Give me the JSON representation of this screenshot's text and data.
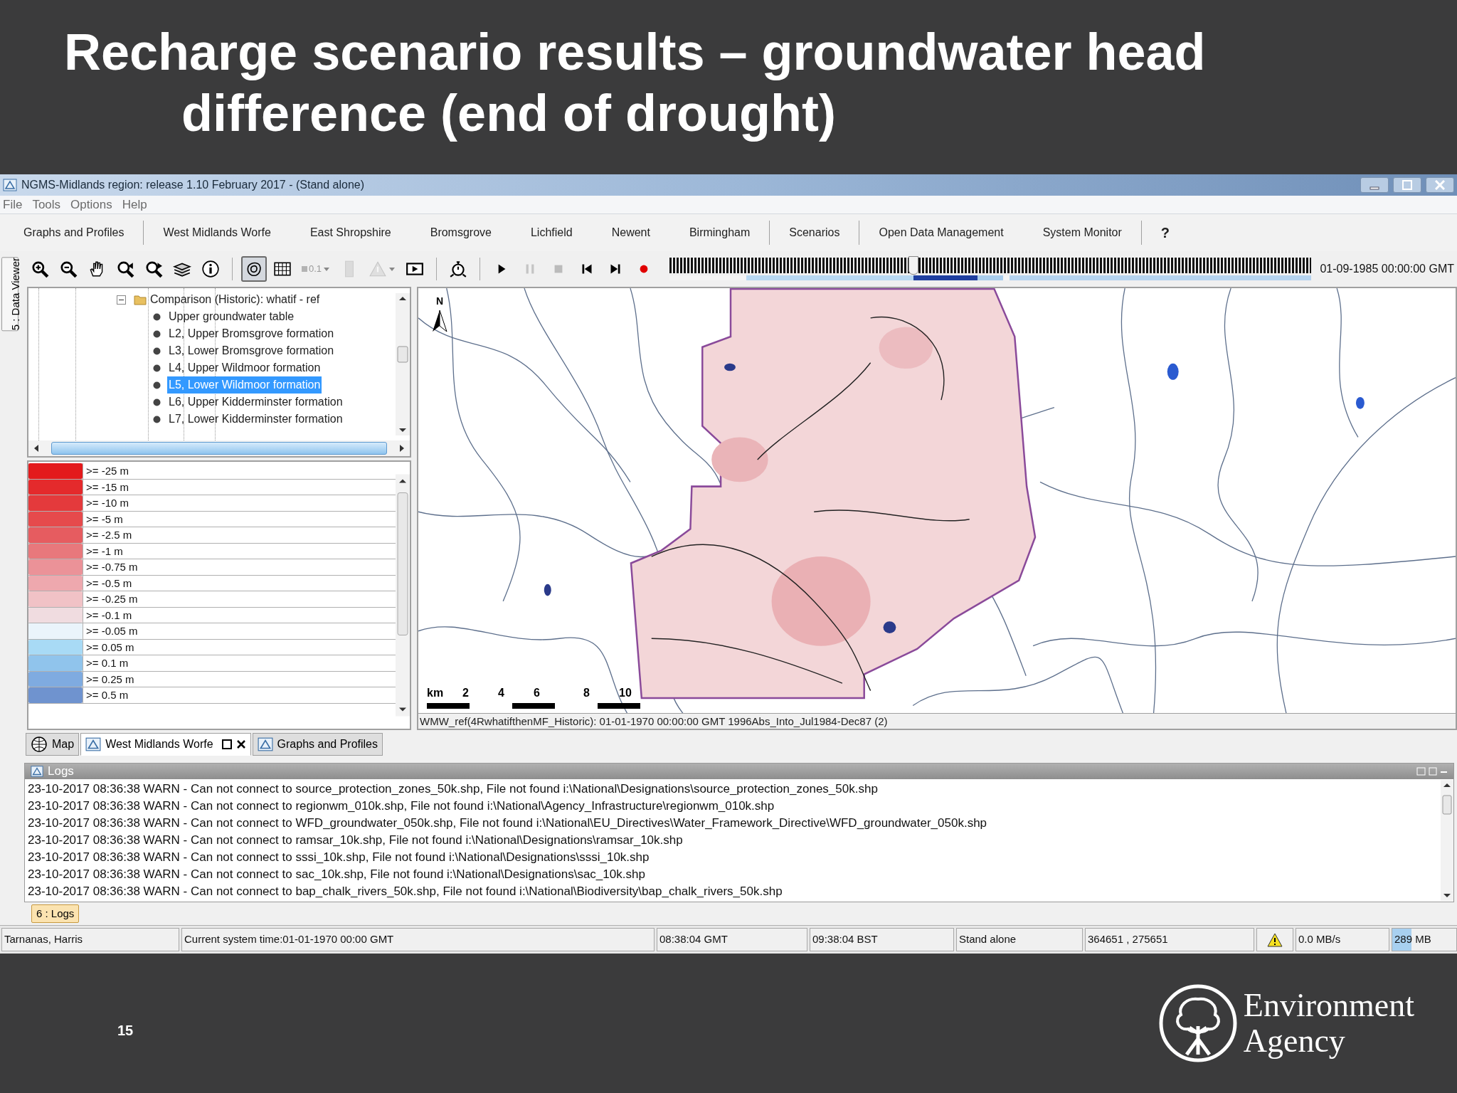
{
  "slide": {
    "title_lines": [
      "Recharge scenario results – groundwater head",
      "difference (end of drought)"
    ],
    "page_number": "15",
    "logo_lines": [
      "Environment",
      "Agency"
    ]
  },
  "window": {
    "title": "NGMS-Midlands region: release 1.10 February 2017 -  (Stand alone)",
    "menu": [
      "File",
      "Tools",
      "Options",
      "Help"
    ],
    "nav_tabs": [
      {
        "label": "Graphs and Profiles",
        "group_end": true
      },
      {
        "label": "West Midlands Worfe",
        "group_end": false
      },
      {
        "label": "East Shropshire",
        "group_end": false
      },
      {
        "label": "Bromsgrove",
        "group_end": false
      },
      {
        "label": "Lichfield",
        "group_end": false
      },
      {
        "label": "Newent",
        "group_end": false
      },
      {
        "label": "Birmingham",
        "group_end": true
      },
      {
        "label": "Scenarios",
        "group_end": true
      },
      {
        "label": "Open Data Management",
        "group_end": false
      },
      {
        "label": "System Monitor",
        "group_end": true
      },
      {
        "label": "?",
        "group_end": false
      }
    ]
  },
  "toolbar": [
    {
      "kind": "zoom-in",
      "pressed": false,
      "disabled": false
    },
    {
      "kind": "zoom-out",
      "pressed": false,
      "disabled": false
    },
    {
      "kind": "pan",
      "pressed": false,
      "disabled": false
    },
    {
      "kind": "zoom-back",
      "pressed": false,
      "disabled": false
    },
    {
      "kind": "zoom-forward",
      "pressed": false,
      "disabled": false
    },
    {
      "kind": "layers",
      "pressed": false,
      "disabled": false
    },
    {
      "kind": "info",
      "pressed": false,
      "disabled": false
    },
    {
      "kind": "separator"
    },
    {
      "kind": "contour",
      "pressed": true,
      "disabled": false
    },
    {
      "kind": "grid",
      "pressed": false,
      "disabled": false
    },
    {
      "kind": "opacity",
      "text": "0.1",
      "pressed": false,
      "disabled": true
    },
    {
      "kind": "bar",
      "pressed": false,
      "disabled": true
    },
    {
      "kind": "warning",
      "pressed": false,
      "disabled": true
    },
    {
      "kind": "present",
      "pressed": false,
      "disabled": false
    },
    {
      "kind": "separator"
    },
    {
      "kind": "timer",
      "pressed": false,
      "disabled": false
    },
    {
      "kind": "separator"
    },
    {
      "kind": "play",
      "pressed": false,
      "disabled": false
    },
    {
      "kind": "pause",
      "pressed": false,
      "disabled": true
    },
    {
      "kind": "stop",
      "pressed": false,
      "disabled": true
    },
    {
      "kind": "first",
      "pressed": false,
      "disabled": false
    },
    {
      "kind": "last",
      "pressed": false,
      "disabled": false
    },
    {
      "kind": "record",
      "pressed": false,
      "disabled": false
    }
  ],
  "time_slider": {
    "level": 0.38,
    "time": "01-09-1985 00:00:00 GMT"
  },
  "side_tab": "5 : Data Viewer",
  "tree": {
    "label": "Comparison (Historic): whatif - ref",
    "expanded": true,
    "children": [
      {
        "label": "Upper groundwater table",
        "selected": false
      },
      {
        "label": "L2, Upper Bromsgrove formation",
        "selected": false
      },
      {
        "label": "L3, Lower Bromsgrove formation",
        "selected": false
      },
      {
        "label": "L4, Upper Wildmoor formation",
        "selected": false
      },
      {
        "label": "L5, Lower Wildmoor formation",
        "selected": true
      },
      {
        "label": "L6, Upper Kidderminster formation",
        "selected": false
      },
      {
        "label": "L7, Lower Kidderminster formation",
        "selected": false
      }
    ]
  },
  "legend": [
    {
      "label": ">= -25 m",
      "color": "#e31a1c"
    },
    {
      "label": ">= -15 m",
      "color": "#e42a2c"
    },
    {
      "label": ">= -10 m",
      "color": "#e43a3c"
    },
    {
      "label": ">= -5 m",
      "color": "#e64a4c"
    },
    {
      "label": ">= -2.5 m",
      "color": "#e65c60"
    },
    {
      "label": ">= -1 m",
      "color": "#e8787c"
    },
    {
      "label": ">= -0.75 m",
      "color": "#eb9298"
    },
    {
      "label": ">= -0.5 m",
      "color": "#eea8ae"
    },
    {
      "label": ">= -0.25 m",
      "color": "#f1c2c6"
    },
    {
      "label": ">= -0.1 m",
      "color": "#f0dce0"
    },
    {
      "label": ">= -0.05 m",
      "color": "#eaf4fb"
    },
    {
      "label": ">= 0.05 m",
      "color": "#a8daf5"
    },
    {
      "label": ">= 0.1 m",
      "color": "#90c4ec"
    },
    {
      "label": ">= 0.25 m",
      "color": "#7fabe0"
    },
    {
      "label": ">= 0.5 m",
      "color": "#6f93cf"
    }
  ],
  "map": {
    "kind": "picture",
    "north": "N",
    "scale_labels": [
      "km",
      "2",
      "4",
      "6",
      "8",
      "10"
    ],
    "caption": "WMW_ref(4RwhatifthenMF_Historic): 01-01-1970 00:00:00 GMT 1996Abs_Into_Jul1984-Dec87 (2)"
  },
  "view_tabs": [
    {
      "label": "Map",
      "kind": "map",
      "selected": false,
      "closable": false
    },
    {
      "label": "West Midlands Worfe",
      "kind": "view",
      "selected": true,
      "closable": true
    },
    {
      "label": "Graphs and Profiles",
      "kind": "view",
      "selected": false,
      "closable": false
    }
  ],
  "logs": {
    "title": "Logs",
    "lines": [
      "23-10-2017 08:36:38 WARN - Can not connect to source_protection_zones_50k.shp, File not found i:\\National\\Designations\\source_protection_zones_50k.shp",
      "23-10-2017 08:36:38 WARN - Can not connect to regionwm_010k.shp, File not found i:\\National\\Agency_Infrastructure\\regionwm_010k.shp",
      "23-10-2017 08:36:38 WARN - Can not connect to WFD_groundwater_050k.shp, File not found i:\\National\\EU_Directives\\Water_Framework_Directive\\WFD_groundwater_050k.shp",
      "23-10-2017 08:36:38 WARN - Can not connect to ramsar_10k.shp, File not found i:\\National\\Designations\\ramsar_10k.shp",
      "23-10-2017 08:36:38 WARN - Can not connect to sssi_10k.shp, File not found i:\\National\\Designations\\sssi_10k.shp",
      "23-10-2017 08:36:38 WARN - Can not connect to sac_10k.shp, File not found i:\\National\\Designations\\sac_10k.shp",
      "23-10-2017 08:36:38 WARN - Can not connect to bap_chalk_rivers_50k.shp, File not found i:\\National\\Biodiversity\\bap_chalk_rivers_50k.shp"
    ]
  },
  "logs_button": "6 : Logs",
  "status_bar": [
    {
      "kind": "text",
      "text": "Tarnanas, Harris"
    },
    {
      "kind": "text",
      "text": "Current system time:01-01-1970 00:00 GMT"
    },
    {
      "kind": "text",
      "text": "08:38:04 GMT"
    },
    {
      "kind": "text",
      "text": "09:38:04 BST"
    },
    {
      "kind": "text",
      "text": "Stand alone"
    },
    {
      "kind": "text",
      "text": "364651 , 275651"
    },
    {
      "kind": "warning"
    },
    {
      "kind": "text",
      "text": "0.0 MB/s"
    },
    {
      "kind": "memory",
      "text": "289 MB",
      "level": 0.3
    }
  ]
}
